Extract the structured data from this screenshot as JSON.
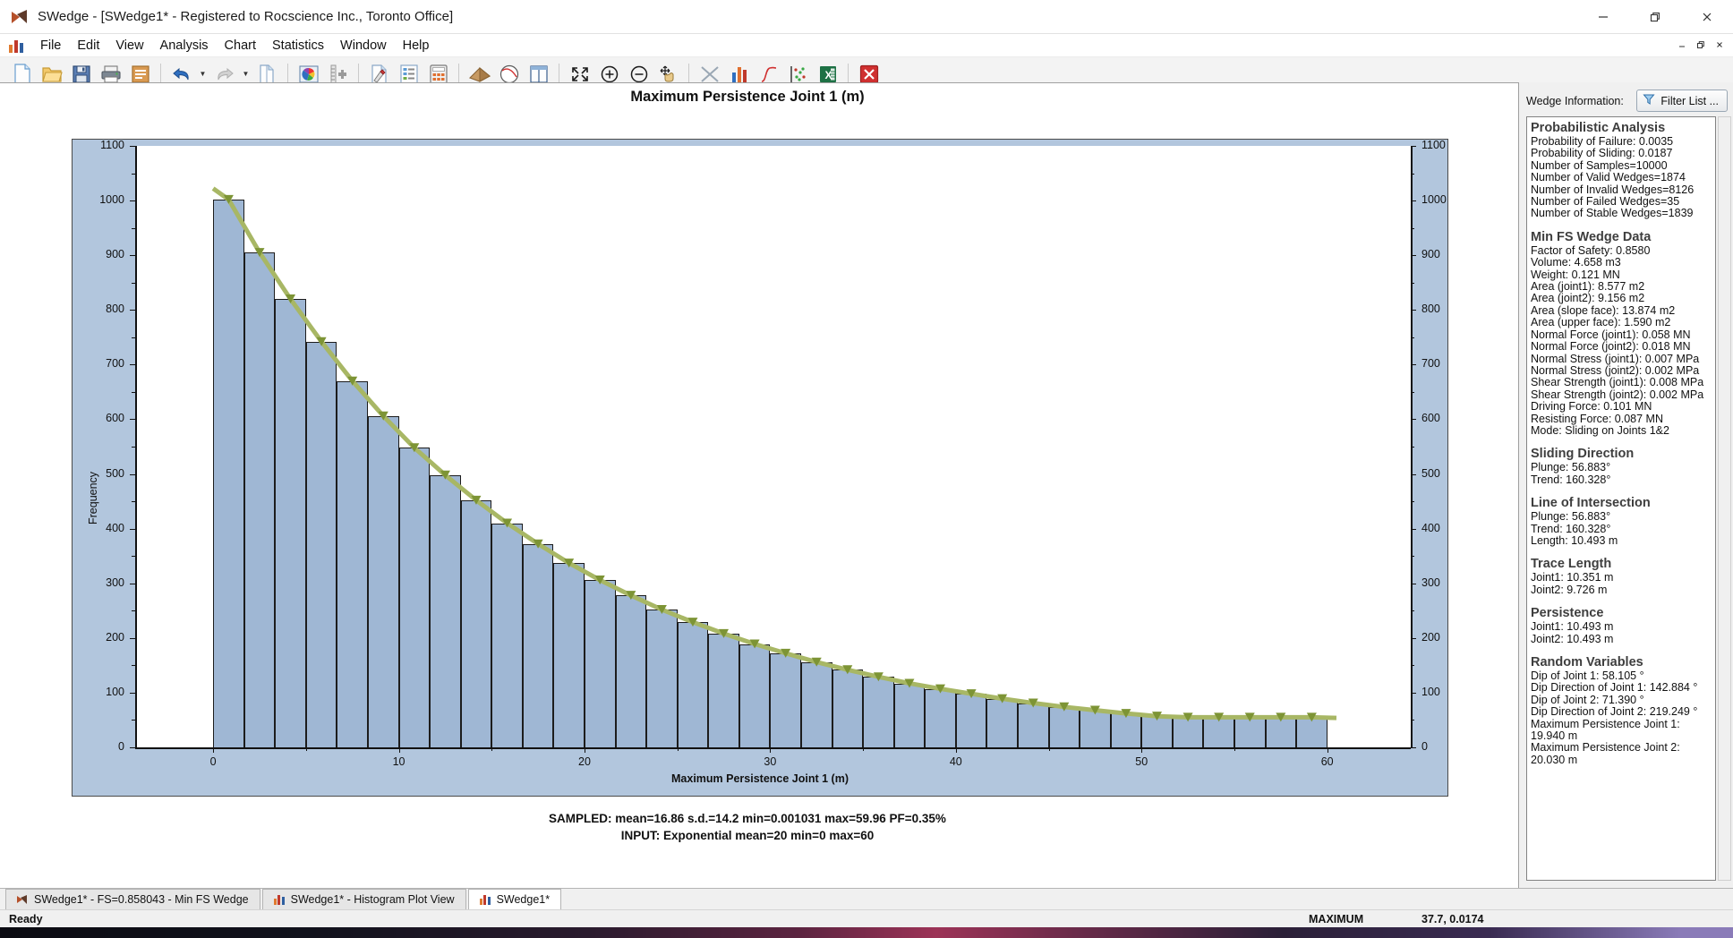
{
  "window": {
    "title": "SWedge - [SWedge1* - Registered to Rocscience Inc., Toronto Office]",
    "app_icon": "swedge-icon",
    "minimize": "–",
    "maximize": "❐",
    "close": "✕"
  },
  "mdi_buttons": {
    "minimize": "–",
    "restore": "❐",
    "close": "✕"
  },
  "menu": {
    "icon": "histogram-icon",
    "items": [
      "File",
      "Edit",
      "View",
      "Analysis",
      "Chart",
      "Statistics",
      "Window",
      "Help"
    ]
  },
  "toolbar": {
    "groups": [
      [
        "new-file",
        "open-folder",
        "save-floppy",
        "print",
        "project-settings"
      ],
      [
        "undo",
        "undo-dropdown",
        "redo",
        "redo-dropdown",
        "copy-page"
      ],
      [
        "color-wheel",
        "scale-ruler"
      ],
      [
        "add-annotation",
        "data-list",
        "calculator"
      ],
      [
        "wedge-view",
        "stereonet",
        "info-viewer"
      ],
      [
        "zoom-extents",
        "zoom-in",
        "zoom-out",
        "pan"
      ],
      [
        "scatter-cross-plot",
        "histogram-plot",
        "cumulative-plot",
        "scatter-plot",
        "export-excel"
      ],
      [
        "close-plot"
      ]
    ]
  },
  "chart_data": {
    "type": "bar",
    "title": "Maximum Persistence Joint 1 (m)",
    "xlabel": "Maximum Persistence Joint 1 (m)",
    "ylabel": "Frequency",
    "xlim": [
      -4.2,
      64.5
    ],
    "ylim": [
      0,
      1100
    ],
    "grid": false,
    "legend": null,
    "bin_width": 1.6667,
    "x_ticks": [
      0,
      10,
      20,
      30,
      40,
      50,
      60
    ],
    "y_ticks": [
      0,
      100,
      200,
      300,
      400,
      500,
      600,
      700,
      800,
      900,
      1000,
      1100
    ],
    "y_minor_ticks": [
      50,
      150,
      250,
      350,
      450,
      550,
      650,
      750,
      850,
      950,
      1050
    ],
    "bin_starts": [
      0.0,
      1.667,
      3.333,
      5.0,
      6.667,
      8.333,
      10.0,
      11.667,
      13.333,
      15.0,
      16.667,
      18.333,
      20.0,
      21.667,
      23.333,
      25.0,
      26.667,
      28.333,
      30.0,
      31.667,
      33.333,
      35.0,
      36.667,
      38.333,
      40.0,
      41.667,
      43.333,
      45.0,
      46.667,
      48.333,
      50.0,
      51.667,
      53.333,
      55.0,
      56.667,
      58.333
    ],
    "values": [
      1002,
      905,
      820,
      742,
      670,
      606,
      548,
      498,
      452,
      410,
      372,
      337,
      306,
      278,
      252,
      229,
      208,
      189,
      172,
      156,
      142,
      129,
      117,
      107,
      98,
      89,
      81,
      74,
      68,
      62,
      57,
      55,
      55,
      55,
      55,
      55
    ],
    "fit_curve": {
      "name": "exponential-fit",
      "color": "#a8b765",
      "marker": "triangle-down",
      "marker_color": "#7d9435"
    },
    "bar_fill": "#9fb7d4",
    "bar_stroke": "#1c1c1c",
    "frame_fill": "#b2c6dd",
    "sampled_line": "SAMPLED: mean=16.86 s.d.=14.2 min=0.001031 max=59.96 PF=0.35%",
    "input_line": "INPUT: Exponential mean=20 min=0 max=60"
  },
  "sidebar": {
    "header_label": "Wedge Information:",
    "filter_button": "Filter List ...",
    "filter_icon": "funnel-icon",
    "sections": [
      {
        "heading": "Probabilistic Analysis",
        "lines": [
          "Probability of Failure: 0.0035",
          "Probability of Sliding: 0.0187",
          "Number of Samples=10000",
          "Number of Valid Wedges=1874",
          "Number of Invalid Wedges=8126",
          "Number of Failed Wedges=35",
          "Number of Stable Wedges=1839"
        ]
      },
      {
        "heading": "Min FS Wedge Data",
        "lines": [
          "Factor of Safety: 0.8580",
          "Volume: 4.658 m3",
          "Weight: 0.121 MN",
          "Area (joint1): 8.577 m2",
          "Area (joint2): 9.156 m2",
          "Area (slope face): 13.874 m2",
          "Area (upper face): 1.590 m2",
          "Normal Force (joint1): 0.058 MN",
          "Normal Force (joint2): 0.018 MN",
          "Normal Stress (joint1): 0.007 MPa",
          "Normal Stress (joint2): 0.002 MPa",
          "Shear Strength (joint1): 0.008 MPa",
          "Shear Strength (joint2): 0.002 MPa",
          "Driving Force: 0.101 MN",
          "Resisting Force: 0.087 MN",
          "Mode: Sliding on Joints 1&2"
        ]
      },
      {
        "heading": "Sliding Direction",
        "lines": [
          "Plunge: 56.883°",
          "Trend: 160.328°"
        ]
      },
      {
        "heading": "Line of Intersection",
        "lines": [
          "Plunge: 56.883°",
          "Trend: 160.328°",
          "Length: 10.493 m"
        ]
      },
      {
        "heading": "Trace Length",
        "lines": [
          "Joint1: 10.351 m",
          "Joint2: 9.726 m"
        ]
      },
      {
        "heading": "Persistence",
        "lines": [
          "Joint1: 10.493 m",
          "Joint2: 10.493 m"
        ]
      },
      {
        "heading": "Random Variables",
        "lines": [
          "Dip of Joint 1: 58.105 °",
          "Dip Direction of Joint 1: 142.884 °",
          "Dip of Joint 2: 71.390 °",
          "Dip Direction of Joint 2: 219.249 °",
          "Maximum Persistence Joint 1:",
          "19.940 m",
          "Maximum Persistence Joint 2:",
          "20.030 m"
        ]
      }
    ]
  },
  "tabs": [
    {
      "label": "SWedge1* - FS=0.858043 - Min FS Wedge",
      "icon": "wedge-icon",
      "active": false
    },
    {
      "label": "SWedge1* - Histogram Plot View",
      "icon": "histogram-icon",
      "active": false
    },
    {
      "label": "SWedge1*",
      "icon": "histogram-icon",
      "active": true
    }
  ],
  "statusbar": {
    "ready": "Ready",
    "mode": "MAXIMUM",
    "coordinates": "37.7, 0.0174"
  }
}
